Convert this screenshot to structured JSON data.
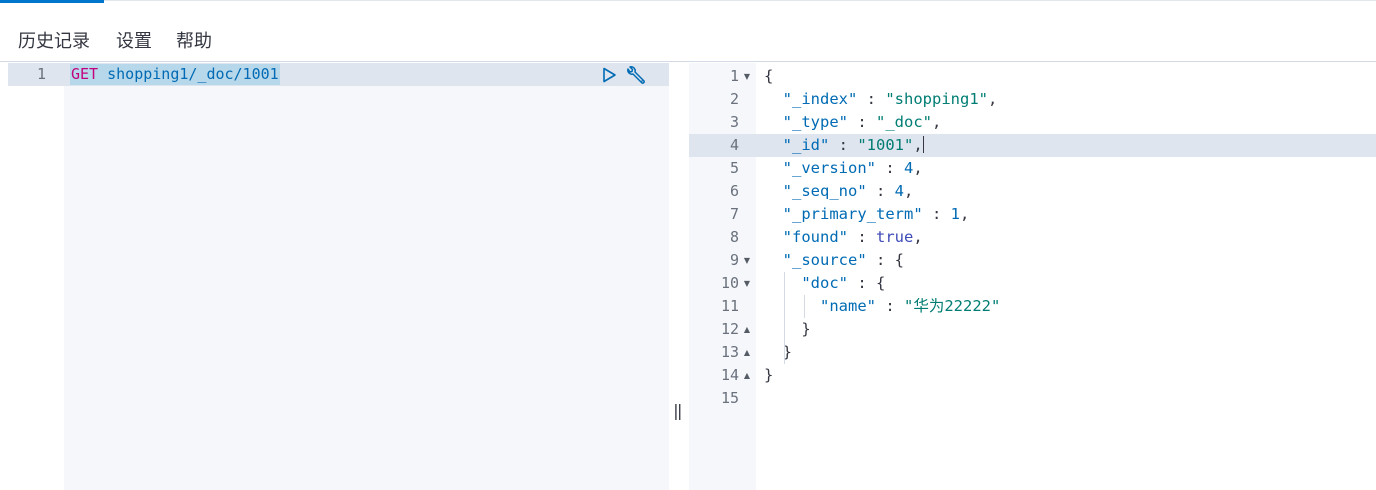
{
  "menu": {
    "history": "历史记录",
    "settings": "设置",
    "help": "帮助"
  },
  "request": {
    "line_number": "1",
    "method": "GET",
    "path": "shopping1/_doc/1001"
  },
  "response": {
    "line_numbers": [
      "1",
      "2",
      "3",
      "4",
      "5",
      "6",
      "7",
      "8",
      "9",
      "10",
      "11",
      "12",
      "13",
      "14",
      "15"
    ],
    "lines": [
      {
        "indent": "",
        "parts": [
          {
            "t": "p",
            "v": "{"
          }
        ]
      },
      {
        "indent": "  ",
        "parts": [
          {
            "t": "k",
            "v": "\"_index\""
          },
          {
            "t": "p",
            "v": " : "
          },
          {
            "t": "s",
            "v": "\"shopping1\""
          },
          {
            "t": "p",
            "v": ","
          }
        ]
      },
      {
        "indent": "  ",
        "parts": [
          {
            "t": "k",
            "v": "\"_type\""
          },
          {
            "t": "p",
            "v": " : "
          },
          {
            "t": "s",
            "v": "\"_doc\""
          },
          {
            "t": "p",
            "v": ","
          }
        ]
      },
      {
        "indent": "  ",
        "parts": [
          {
            "t": "k",
            "v": "\"_id\""
          },
          {
            "t": "p",
            "v": " : "
          },
          {
            "t": "s",
            "v": "\"1001\""
          },
          {
            "t": "p",
            "v": ","
          }
        ]
      },
      {
        "indent": "  ",
        "parts": [
          {
            "t": "k",
            "v": "\"_version\""
          },
          {
            "t": "p",
            "v": " : "
          },
          {
            "t": "n",
            "v": "4"
          },
          {
            "t": "p",
            "v": ","
          }
        ]
      },
      {
        "indent": "  ",
        "parts": [
          {
            "t": "k",
            "v": "\"_seq_no\""
          },
          {
            "t": "p",
            "v": " : "
          },
          {
            "t": "n",
            "v": "4"
          },
          {
            "t": "p",
            "v": ","
          }
        ]
      },
      {
        "indent": "  ",
        "parts": [
          {
            "t": "k",
            "v": "\"_primary_term\""
          },
          {
            "t": "p",
            "v": " : "
          },
          {
            "t": "n",
            "v": "1"
          },
          {
            "t": "p",
            "v": ","
          }
        ]
      },
      {
        "indent": "  ",
        "parts": [
          {
            "t": "k",
            "v": "\"found\""
          },
          {
            "t": "p",
            "v": " : "
          },
          {
            "t": "b",
            "v": "true"
          },
          {
            "t": "p",
            "v": ","
          }
        ]
      },
      {
        "indent": "  ",
        "parts": [
          {
            "t": "k",
            "v": "\"_source\""
          },
          {
            "t": "p",
            "v": " : {"
          }
        ]
      },
      {
        "indent": "    ",
        "parts": [
          {
            "t": "k",
            "v": "\"doc\""
          },
          {
            "t": "p",
            "v": " : {"
          }
        ]
      },
      {
        "indent": "      ",
        "parts": [
          {
            "t": "k",
            "v": "\"name\""
          },
          {
            "t": "p",
            "v": " : "
          },
          {
            "t": "s",
            "v": "\"华为22222\""
          }
        ]
      },
      {
        "indent": "    ",
        "parts": [
          {
            "t": "p",
            "v": "}"
          }
        ]
      },
      {
        "indent": "  ",
        "parts": [
          {
            "t": "p",
            "v": "}"
          }
        ]
      },
      {
        "indent": "",
        "parts": [
          {
            "t": "p",
            "v": "}"
          }
        ]
      },
      {
        "indent": "",
        "parts": []
      }
    ],
    "fold": [
      "down",
      "",
      "",
      "",
      "",
      "",
      "",
      "",
      "down",
      "down",
      "",
      "up",
      "up",
      "up",
      ""
    ]
  },
  "icons": {
    "run": "play-icon",
    "settings": "wrench-icon",
    "resize": "resize-handle-icon"
  },
  "resize_glyph": "‖",
  "colors": {
    "accent": "#0077cc",
    "method": "#c3007d",
    "key": "#006bb4",
    "string": "#017d73"
  }
}
